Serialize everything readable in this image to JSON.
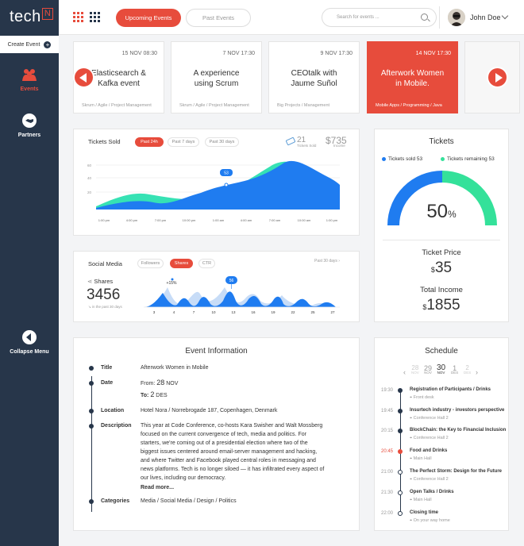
{
  "app": {
    "logo": "tech",
    "logo_mark": "N"
  },
  "sidebar": {
    "create_event": "Create Event",
    "events": "Events",
    "partners": "Partners",
    "collapse": "Collapse Menu"
  },
  "topbar": {
    "tab_upcoming": "Upcoming Events",
    "tab_past": "Past Events",
    "search_placeholder": "Search for events ...",
    "user_name": "John Doe"
  },
  "carousel": [
    {
      "date": "15 NOV 08:30",
      "title": "Elasticsearch &\nKafka event",
      "tags": "Skrum / Agile / Project Management"
    },
    {
      "date": "7 NOV 17:30",
      "title": "A experience\nusing Scrum",
      "tags": "Skrum / Agile / Project Management"
    },
    {
      "date": "9 NOV 17:30",
      "title": "CEOtalk with\nJaume Suñol",
      "tags": "Big Projects / Management"
    },
    {
      "date": "14 NOV 17:30",
      "title": "Afterwork Women\nin Mobile.",
      "tags": "Mobile Apps / Programming / Java"
    }
  ],
  "tickets_sold": {
    "title": "Tickets Sold",
    "filters": [
      "Past 24h",
      "Past 7 days",
      "Past 30 days"
    ],
    "active_filter": "Past 24h",
    "count": "21",
    "count_label": "Tickets Sold",
    "amount": "$735",
    "amount_label": "Income",
    "tooltip": "53",
    "y_ticks": [
      "60",
      "40",
      "20"
    ],
    "x_ticks": [
      "1:00 pm",
      "4:00 pm",
      "7:00 pm",
      "10:00 pm",
      "1:00 am",
      "4:00 am",
      "7:00 am",
      "10:00 am",
      "1:00 pm"
    ]
  },
  "social": {
    "title": "Social Media",
    "filters": [
      "Followers",
      "Shares",
      "CTR"
    ],
    "active_filter": "Shares",
    "period": "Past 30 days",
    "metric_label": "Shares",
    "metric_value": "3456",
    "metric_note": "in the past 30 days",
    "delta": "+15%",
    "tooltip": "56",
    "x_ticks": [
      "3",
      "4",
      "7",
      "10",
      "13",
      "16",
      "19",
      "22",
      "25",
      "27"
    ]
  },
  "tickets": {
    "title": "Tickets",
    "legend_sold": "Tickets sold 53",
    "legend_remaining": "Tickets remaining 53",
    "percent": "50",
    "percent_sign": "%",
    "percent_value": 0.5,
    "price_label": "Ticket Price",
    "price_currency": "$",
    "price": "35",
    "income_label": "Total Income",
    "income_currency": "$",
    "income": "1855",
    "colors": {
      "sold": "#1f7cf0",
      "remaining": "#34e19a"
    }
  },
  "event_info": {
    "title": "Event Information",
    "rows": {
      "title_label": "Title",
      "title_value": "Afterwork Women in Mobile",
      "date_label": "Date",
      "from_label": "From:",
      "from_day": "28",
      "from_month": "NOV",
      "to_label": "To:",
      "to_day": "2",
      "to_month": "DES",
      "location_label": "Location",
      "location_value": "Hotel Nora / Norrebrogade 187, Copenhagen, Denmark",
      "description_label": "Description",
      "description_lines": [
        "This year at Code Conference, co-hosts Kara Swisher and Walt Mossberg",
        "focused on the current convergence of tech, media and politics. For",
        "starters, we're coming out of a presidential election where two of the",
        "biggest issues centered around email-server management and hacking,",
        "and where Twitter and Facebook played central roles in messaging and",
        "news platforms. Tech is no longer siloed — it has infiltrated every aspect of",
        "our lives, including our democracy."
      ],
      "read_more": "Read more...",
      "categories_label": "Categories",
      "categories_value": "Media / Social Media / Design / Politics"
    }
  },
  "schedule": {
    "title": "Schedule",
    "days": [
      {
        "d": "28",
        "m": "NOV"
      },
      {
        "d": "29",
        "m": "NOV"
      },
      {
        "d": "30",
        "m": "NOV"
      },
      {
        "d": "1",
        "m": "DES"
      },
      {
        "d": "2",
        "m": "DES"
      }
    ],
    "items": [
      {
        "time": "19:30",
        "name": "Registration of Participants / Drinks",
        "place": "Front desk"
      },
      {
        "time": "19:45",
        "name": "Insurtech industry - investors perspective",
        "place": "Conference Hall 2"
      },
      {
        "time": "20:15",
        "name": "BlockChain: the Key to Financial Inclusion",
        "place": "Conference Hall 2"
      },
      {
        "time": "20:45",
        "name": "Food and Drinks",
        "place": "Main Hall"
      },
      {
        "time": "21:00",
        "name": "The Perfect Storm: Design for the Future",
        "place": "Conference Hall 2"
      },
      {
        "time": "21:30",
        "name": "Open Talks / Drinks",
        "place": "Main Hall"
      },
      {
        "time": "22:00",
        "name": "Closing time",
        "place": "On your way home"
      }
    ]
  }
}
